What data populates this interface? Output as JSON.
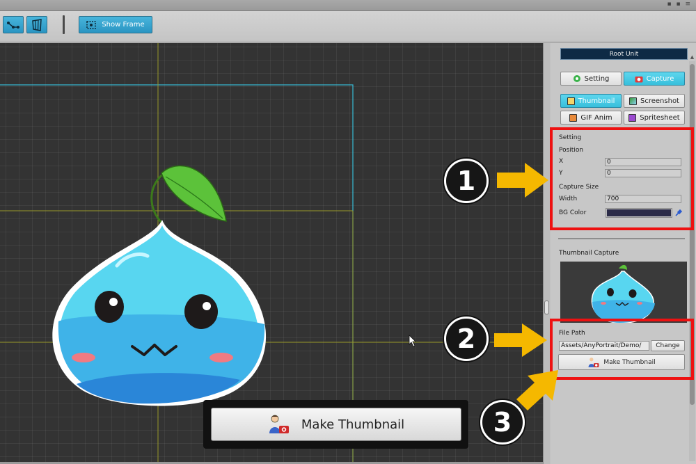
{
  "titlebar": {
    "icons": "▪ ▪ ≡"
  },
  "toolbar": {
    "show_frame_label": "Show Frame"
  },
  "panel": {
    "root_unit": "Root Unit",
    "tabs": {
      "setting": "Setting",
      "capture": "Capture"
    },
    "capture_modes": {
      "thumbnail": "Thumbnail",
      "screenshot": "Screenshot",
      "gif_anim": "GIF Anim",
      "spritesheet": "Spritesheet"
    },
    "setting_section": {
      "title": "Setting",
      "position_label": "Position",
      "x_label": "X",
      "x_value": "0",
      "y_label": "Y",
      "y_value": "0",
      "capture_size_label": "Capture Size",
      "width_label": "Width",
      "width_value": "700",
      "bg_color_label": "BG Color",
      "bg_color": "#2b2b48"
    },
    "thumbnail_capture": {
      "title": "Thumbnail Capture",
      "file_path_label": "File Path",
      "file_path_value": "Assets/AnyPortrait/Demo/",
      "change_label": "Change",
      "make_thumbnail_label": "Make Thumbnail"
    }
  },
  "callout": {
    "make_thumbnail_label": "Make Thumbnail"
  },
  "badges": [
    "1",
    "2",
    "3"
  ],
  "colors": {
    "accent": "#37bfdc",
    "highlight": "#ee1111",
    "arrow": "#f5b800",
    "canvas_bg": "#333333"
  }
}
